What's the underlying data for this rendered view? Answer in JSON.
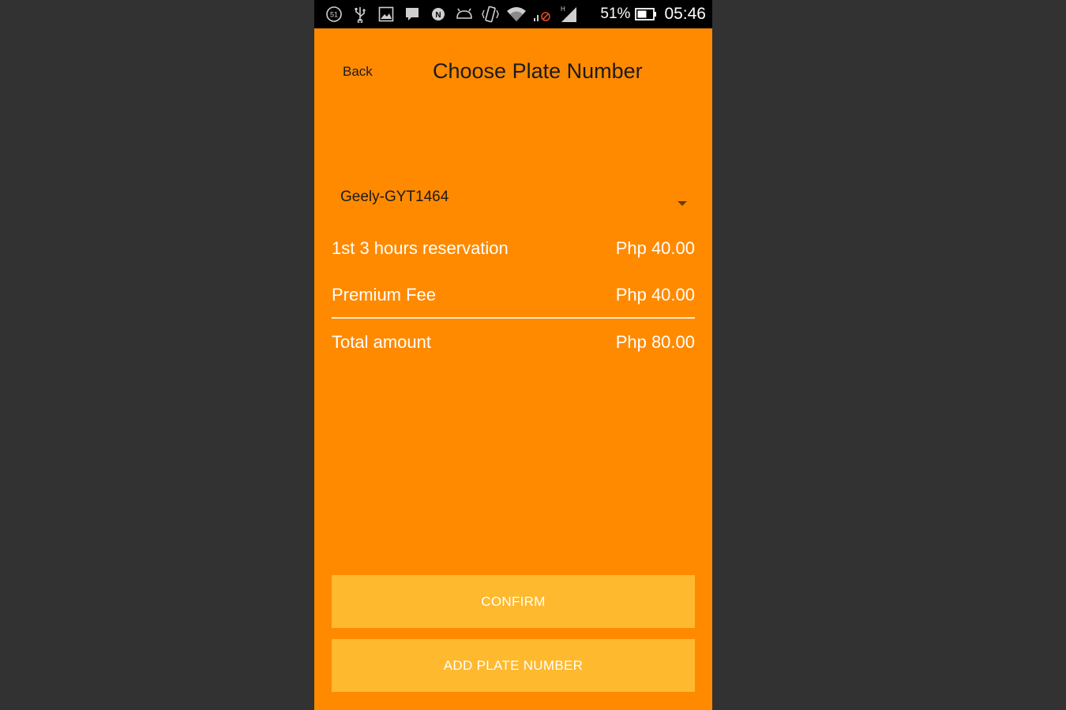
{
  "status_bar": {
    "notification_badge": "51",
    "battery_percent": "51%",
    "time": "05:46",
    "icons": [
      "notification-count-icon",
      "usb-icon",
      "image-icon",
      "message-icon",
      "nfc-icon",
      "android-icon",
      "vibrate-icon",
      "wifi-icon",
      "data-off-icon",
      "signal-icon",
      "battery-icon"
    ]
  },
  "header": {
    "back_label": "Back",
    "title": "Choose Plate Number"
  },
  "plate_select": {
    "selected": "Geely-GYT1464"
  },
  "fees": {
    "reservation_label": "1st 3 hours reservation",
    "reservation_amount": "Php 40.00",
    "premium_label": "Premium Fee",
    "premium_amount": "Php 40.00",
    "total_label": "Total amount",
    "total_amount": "Php 80.00"
  },
  "buttons": {
    "confirm": "CONFIRM",
    "add_plate": "ADD PLATE NUMBER"
  },
  "colors": {
    "background": "#ff8a00",
    "button": "#ffb92e",
    "page_backdrop": "#323232"
  }
}
